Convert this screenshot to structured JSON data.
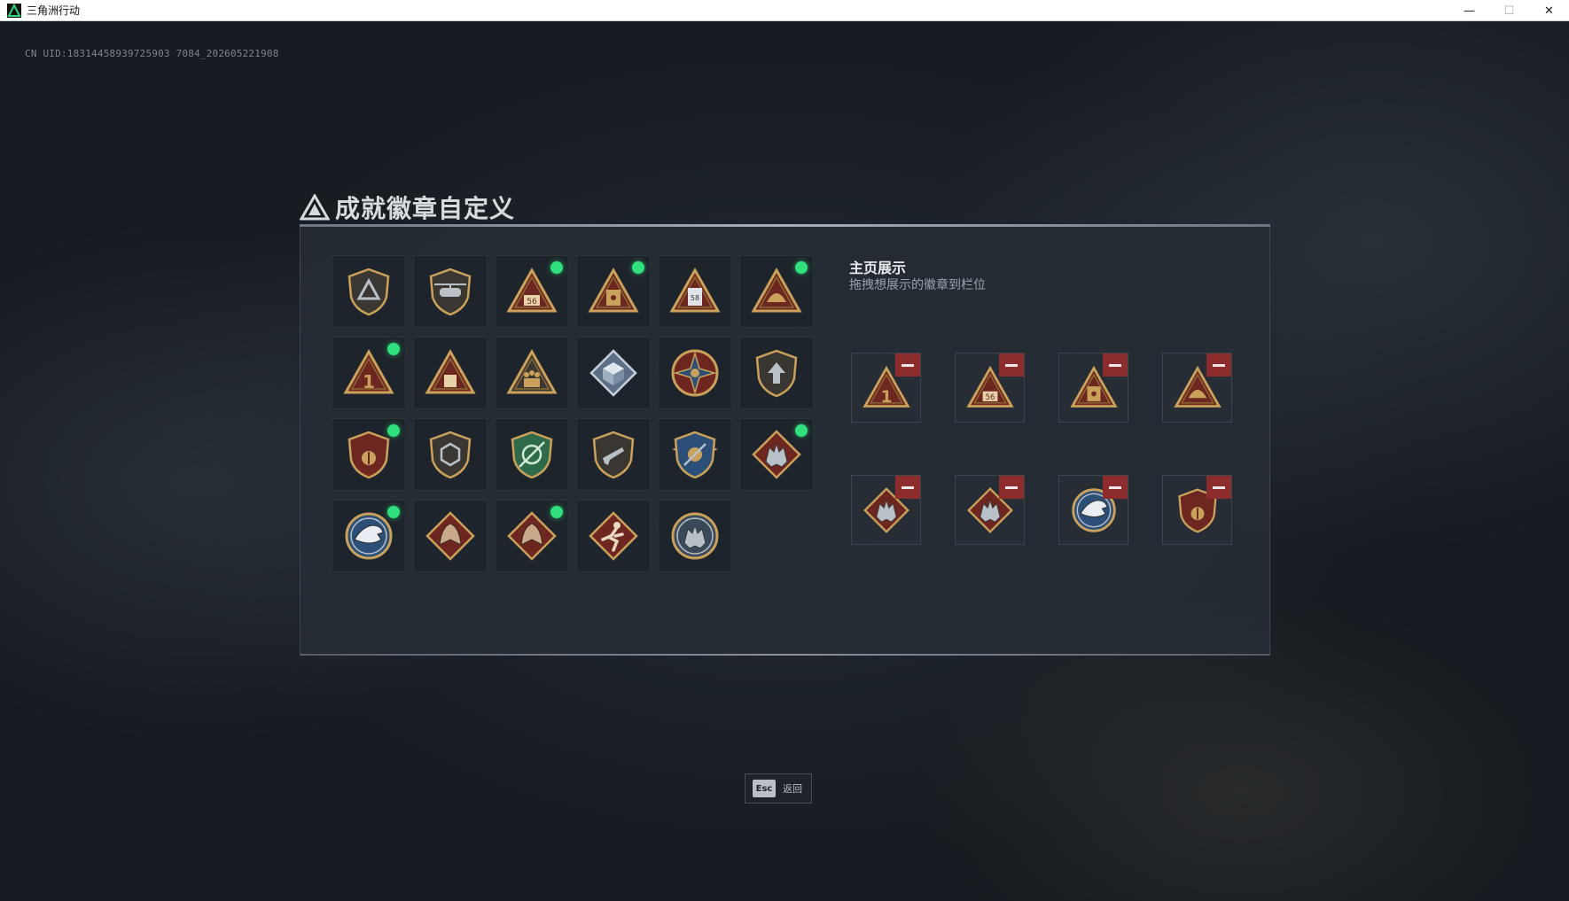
{
  "window": {
    "title": "三角洲行动",
    "minimize": "—",
    "maximize": "☐",
    "close": "✕"
  },
  "uid_text": "CN UID:18314458939725903 7084_202605221908",
  "header": {
    "title": "成就徽章自定义",
    "icon": "delta-logo-icon"
  },
  "badges": [
    {
      "icon": "shield-delta-badge",
      "new": false
    },
    {
      "icon": "helicopter-badge",
      "new": false
    },
    {
      "icon": "triangle-56-badge",
      "new": true
    },
    {
      "icon": "triangle-vault-badge",
      "new": true
    },
    {
      "icon": "triangle-58-badge",
      "new": false
    },
    {
      "icon": "triangle-helmet-badge",
      "new": true
    },
    {
      "icon": "triangle-1-badge",
      "new": true
    },
    {
      "icon": "triangle-crate-badge",
      "new": false
    },
    {
      "icon": "triangle-squad-badge",
      "new": false
    },
    {
      "icon": "cube-diamond-badge",
      "new": false
    },
    {
      "icon": "compass-emblem-badge",
      "new": false
    },
    {
      "icon": "shield-arrow-badge",
      "new": false
    },
    {
      "icon": "crowned-shield-badge",
      "new": true
    },
    {
      "icon": "hex-shield-badge",
      "new": false
    },
    {
      "icon": "green-crosshair-shield-badge",
      "new": false
    },
    {
      "icon": "rifle-shield-badge",
      "new": false
    },
    {
      "icon": "winged-shield-badge",
      "new": false
    },
    {
      "icon": "wolf-diamond-badge",
      "new": true
    },
    {
      "icon": "eagle-circle-badge",
      "new": true
    },
    {
      "icon": "dragon-diamond-badge",
      "new": false
    },
    {
      "icon": "dragon-diamond-badge",
      "new": true
    },
    {
      "icon": "runner-diamond-badge",
      "new": false
    },
    {
      "icon": "wolf-circle-badge",
      "new": false
    }
  ],
  "showcase": {
    "title": "主页展示",
    "subtitle": "拖拽想展示的徽章到栏位",
    "slots": [
      {
        "icon": "triangle-1-badge"
      },
      {
        "icon": "triangle-56-badge"
      },
      {
        "icon": "triangle-vault-badge"
      },
      {
        "icon": "triangle-helmet-badge"
      },
      {
        "icon": "wolf-diamond-badge"
      },
      {
        "icon": "wolf-diamond-badge"
      },
      {
        "icon": "eagle-circle-badge"
      },
      {
        "icon": "crowned-shield-badge"
      }
    ]
  },
  "footer": {
    "key": "Esc",
    "label": "返回"
  },
  "colors": {
    "new_dot": "#2fe07c",
    "remove": "#8c2c2c",
    "gold": "#c9a15a",
    "maroon": "#7a2a24"
  }
}
